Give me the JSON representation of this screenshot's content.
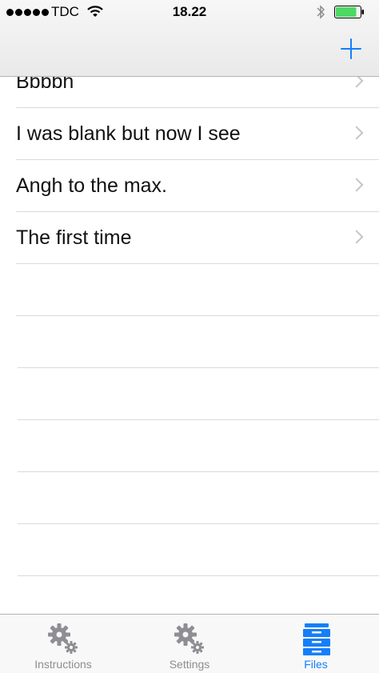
{
  "status_bar": {
    "carrier": "TDC",
    "time": "18.22",
    "signal_icon": "signal-dots-icon",
    "wifi_icon": "wifi-icon",
    "bluetooth_icon": "bluetooth-icon",
    "battery_icon": "battery-icon",
    "battery_level": 0.85,
    "battery_color": "#4cd964"
  },
  "nav_bar": {
    "add_icon": "plus-icon",
    "accent_color": "#147efb"
  },
  "files": {
    "items": [
      {
        "title": "Bbbbh"
      },
      {
        "title": "I was blank but now I see"
      },
      {
        "title": "Angh to the max."
      },
      {
        "title": "The first time"
      }
    ]
  },
  "tab_bar": {
    "tabs": [
      {
        "label": "Instructions",
        "icon": "gears-icon",
        "active": false
      },
      {
        "label": "Settings",
        "icon": "gears-icon",
        "active": false
      },
      {
        "label": "Files",
        "icon": "file-cabinet-icon",
        "active": true
      }
    ],
    "active_color": "#147efb",
    "inactive_color": "#8e8e93"
  }
}
